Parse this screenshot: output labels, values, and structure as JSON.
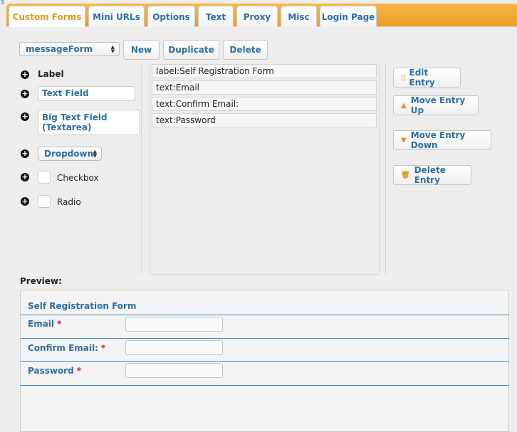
{
  "corner_mark": "3",
  "tabs": [
    {
      "label": "Custom Forms",
      "active": true
    },
    {
      "label": "Mini URLs"
    },
    {
      "label": "Options"
    },
    {
      "label": "Text"
    },
    {
      "label": "Proxy"
    },
    {
      "label": "Misc"
    },
    {
      "label": "Login Page"
    }
  ],
  "toolbar": {
    "form_select": "messageForm",
    "new_label": "New",
    "duplicate_label": "Duplicate",
    "delete_label": "Delete"
  },
  "palette": {
    "label": "Label",
    "text_field": "Text Field",
    "textarea_line1": "Big Text Field",
    "textarea_line2": "(Textarea)",
    "dropdown": "Dropdown",
    "checkbox": "Checkbox",
    "radio": "Radio"
  },
  "entries": [
    "label:Self Registration Form",
    "text:Email",
    "text:Confirm Email:",
    "text:Password"
  ],
  "actions": {
    "edit": "Edit Entry",
    "move_up": "Move Entry Up",
    "move_down": "Move Entry Down",
    "delete": "Delete Entry"
  },
  "preview": {
    "heading": "Preview:",
    "title": "Self Registration Form",
    "required_mark": "*",
    "fields": [
      {
        "label": "Email"
      },
      {
        "label": "Confirm Email:"
      },
      {
        "label": "Password"
      }
    ]
  },
  "colors": {
    "accent_orange": "#ee9c22",
    "link_blue": "#2c6fa6",
    "required_red": "#d01818"
  }
}
